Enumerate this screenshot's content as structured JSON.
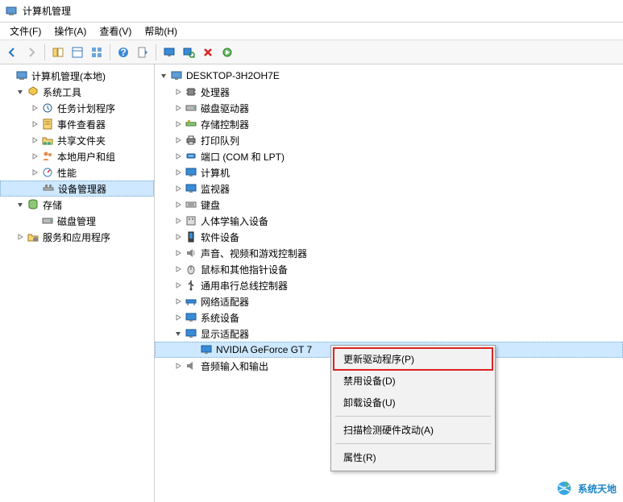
{
  "window": {
    "title": "计算机管理"
  },
  "menu": {
    "file": "文件(F)",
    "action": "操作(A)",
    "view": "查看(V)",
    "help": "帮助(H)"
  },
  "left_tree": {
    "root": "计算机管理(本地)",
    "system_tools": "系统工具",
    "task_scheduler": "任务计划程序",
    "event_viewer": "事件查看器",
    "shared_folders": "共享文件夹",
    "local_users": "本地用户和组",
    "performance": "性能",
    "device_manager": "设备管理器",
    "storage": "存储",
    "disk_mgmt": "磁盘管理",
    "services_apps": "服务和应用程序"
  },
  "right_tree": {
    "computer": "DESKTOP-3H2OH7E",
    "processor": "处理器",
    "disk_drives": "磁盘驱动器",
    "storage_ctrl": "存储控制器",
    "print_queue": "打印队列",
    "ports": "端口 (COM 和 LPT)",
    "computers": "计算机",
    "monitors": "监视器",
    "keyboards": "键盘",
    "hid": "人体学输入设备",
    "software_dev": "软件设备",
    "sound": "声音、视频和游戏控制器",
    "mice": "鼠标和其他指针设备",
    "usb": "通用串行总线控制器",
    "network": "网络适配器",
    "system_dev": "系统设备",
    "display": "显示适配器",
    "gpu": "NVIDIA GeForce GT 7",
    "audio": "音频输入和输出"
  },
  "context_menu": {
    "update_driver": "更新驱动程序(P)",
    "disable": "禁用设备(D)",
    "uninstall": "卸载设备(U)",
    "scan": "扫描检测硬件改动(A)",
    "properties": "属性(R)"
  },
  "watermark": "系统天地"
}
